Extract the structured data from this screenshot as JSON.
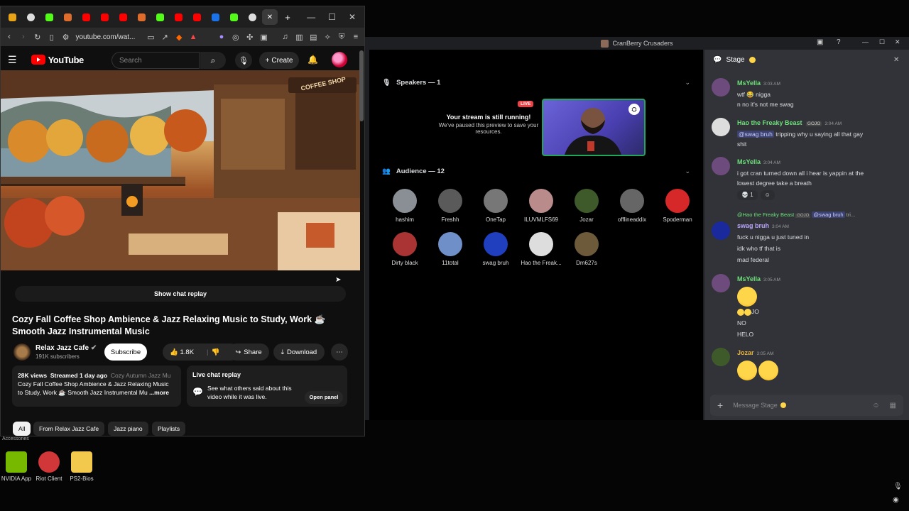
{
  "browser": {
    "tabs_count": 12,
    "url": "youtube.com/wat...",
    "close_tab": "✕",
    "new_tab": "+"
  },
  "youtube": {
    "logo_text": "YouTube",
    "search_placeholder": "Search",
    "create_label": "Create",
    "show_chat_replay": "Show chat replay",
    "video_title": "Cozy Fall Coffee Shop Ambience & Jazz Relaxing Music to Study, Work ☕ Smooth Jazz Instrumental Music",
    "channel_name": "Relax Jazz Cafe",
    "subscribers": "191K subscribers",
    "subscribe_label": "Subscribe",
    "likes": "1.8K",
    "share_label": "Share",
    "download_label": "Download",
    "views": "28K views",
    "streamed": "Streamed 1 day ago",
    "desc_tags": "Cozy Autumn Jazz Mu",
    "desc_line2": "Cozy Fall Coffee Shop Ambience & Jazz Relaxing Music",
    "desc_line3": "to Study, Work ☕ Smooth Jazz Instrumental Mu",
    "desc_more": "...more",
    "live_chat_replay_title": "Live chat replay",
    "live_chat_replay_text": "See what others said about this video while it was live.",
    "open_panel": "Open panel",
    "chips": [
      "All",
      "From Relax Jazz Cafe",
      "Jazz piano",
      "Playlists"
    ],
    "thumb_sign": "COFFEE SHOP"
  },
  "desktop": {
    "accessories_label": "Accessories",
    "icons": [
      {
        "label": "NVIDIA App",
        "color": "#76b900"
      },
      {
        "label": "Riot Client",
        "color": "#d13639"
      },
      {
        "label": "PS2-Bios",
        "color": "#f2c94c"
      }
    ]
  },
  "discord": {
    "window_title": "CranBerry Crusaders",
    "speakers_header": "Speakers — 1",
    "live_badge": "LIVE",
    "stream_running_title": "Your stream is still running!",
    "stream_running_text": "We've paused this preview to save your resources.",
    "audience_header": "Audience — 12",
    "audience": [
      {
        "name": "hashim",
        "color": "#8a8f96"
      },
      {
        "name": "Freshh",
        "color": "#5a5a5a"
      },
      {
        "name": "OneTap",
        "color": "#777"
      },
      {
        "name": "ILUVMLFS69",
        "color": "#b98b8b"
      },
      {
        "name": "Jozar",
        "color": "#3e5a2a"
      },
      {
        "name": "offlineaddix",
        "color": "#666"
      },
      {
        "name": "Spoderman",
        "color": "#d62828"
      },
      {
        "name": "Dirty black",
        "color": "#a33"
      },
      {
        "name": "11total",
        "color": "#6f8fc9"
      },
      {
        "name": "swag bruh",
        "color": "#1f3fbf"
      },
      {
        "name": "Hao the Freak...",
        "color": "#ddd"
      },
      {
        "name": "Dm627s",
        "color": "#6d5a3a"
      }
    ],
    "chat_header": "Stage",
    "messages": [
      {
        "user": "MsYella",
        "time": "3:03 AM",
        "lines": [
          "wtf 😂 nigga",
          "n no it's not me swag"
        ]
      },
      {
        "user": "Hao the Freaky Beast",
        "tag": "GOJO",
        "time": "3:04 AM",
        "mention": "@swag bruh",
        "lines": [
          "tripping why u saying all that gay",
          "shit"
        ]
      },
      {
        "user": "MsYella",
        "time": "3:04 AM",
        "lines": [
          "i got cran turned down all i hear is yappin at the",
          "lowest degree take a breath"
        ],
        "reaction_count": "1"
      },
      {
        "user": "swag bruh",
        "time": "3:04 AM",
        "reply_to": "@Hao the Freaky Beast",
        "reply_tag": "GOJO",
        "reply_mention": "@swag bruh",
        "reply_snip": "tri...",
        "lines": [
          "fuck u nigga u just tuned in",
          "idk who tf that is",
          "mad federal"
        ]
      },
      {
        "user": "MsYella",
        "time": "3:05 AM",
        "lines": [
          "JO",
          "NO",
          "HELO"
        ]
      },
      {
        "user": "Jozar",
        "time": "3:05 AM",
        "lines": []
      }
    ],
    "input_placeholder": "Message Stage"
  }
}
